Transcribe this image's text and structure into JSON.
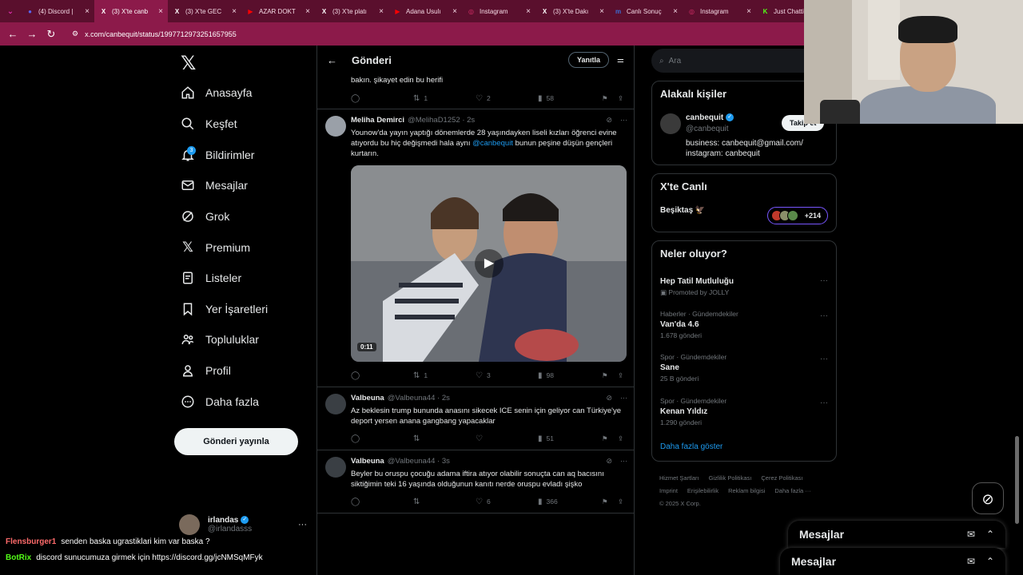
{
  "browser": {
    "tabs": [
      {
        "label": "(4) Discord |",
        "icon": "discord-icon",
        "icon_char": "●",
        "icon_color": "#5865f2",
        "active": false
      },
      {
        "label": "(3) X'te canb",
        "icon": "x-icon",
        "icon_char": "X",
        "icon_color": "#ffffff",
        "active": true
      },
      {
        "label": "(3) X'te GEC",
        "icon": "x-icon",
        "icon_char": "X",
        "icon_color": "#ffffff",
        "active": false
      },
      {
        "label": "AZAR DOKT",
        "icon": "youtube-icon",
        "icon_char": "▶",
        "icon_color": "#ff0000",
        "active": false
      },
      {
        "label": "(3) X'te platı",
        "icon": "x-icon",
        "icon_char": "X",
        "icon_color": "#ffffff",
        "active": false
      },
      {
        "label": "Adana Usulı",
        "icon": "youtube-icon",
        "icon_char": "▶",
        "icon_color": "#ff0000",
        "active": false
      },
      {
        "label": "Instagram",
        "icon": "instagram-icon",
        "icon_char": "◎",
        "icon_color": "#e1306c",
        "active": false
      },
      {
        "label": "(3) X'te Dakı",
        "icon": "x-icon",
        "icon_char": "X",
        "icon_color": "#ffffff",
        "active": false
      },
      {
        "label": "Canlı Sonuç",
        "icon": "mackolik-icon",
        "icon_char": "m",
        "icon_color": "#3b6fd6",
        "active": false
      },
      {
        "label": "Instagram",
        "icon": "instagram-icon",
        "icon_char": "◎",
        "icon_color": "#e1306c",
        "active": false
      },
      {
        "label": "Just Chatti",
        "icon": "kick-icon",
        "icon_char": "K",
        "icon_color": "#53fc18",
        "active": false
      }
    ],
    "url": "x.com/canbequit/status/1997712973251657955"
  },
  "sidebar": {
    "items": [
      {
        "label": "Anasayfa",
        "icon": "home-icon"
      },
      {
        "label": "Keşfet",
        "icon": "search-icon"
      },
      {
        "label": "Bildirimler",
        "icon": "bell-icon",
        "badge": "3"
      },
      {
        "label": "Mesajlar",
        "icon": "mail-icon"
      },
      {
        "label": "Grok",
        "icon": "grok-icon"
      },
      {
        "label": "Premium",
        "icon": "x-logo-icon"
      },
      {
        "label": "Listeler",
        "icon": "list-icon"
      },
      {
        "label": "Yer İşaretleri",
        "icon": "bookmark-icon"
      },
      {
        "label": "Topluluklar",
        "icon": "communities-icon"
      },
      {
        "label": "Profil",
        "icon": "person-icon"
      },
      {
        "label": "Daha fazla",
        "icon": "more-circle-icon"
      }
    ],
    "post_button": "Gönderi yayınla",
    "account": {
      "name": "irlandas",
      "handle": "@irlandasss"
    }
  },
  "main": {
    "title": "Gönderi",
    "reply_button": "Yanıtla",
    "top_fragment": "bakın. şikayet edin bu herifi",
    "top_actions": {
      "replies": "",
      "reposts": "1",
      "likes": "2",
      "views": "58"
    },
    "tweets": [
      {
        "name": "Meliha Demirci",
        "meta": "@MelihaD1252 · 2s",
        "text_before": "Younow'da yayın yaptığı dönemlerde 28 yaşındayken liseli kızları öğrenci evine atıyordu bu hiç değişmedi hala aynı ",
        "mention": "@canbequit",
        "text_after": " bunun peşine düşün gençleri kurtarın.",
        "video_time": "0:11",
        "actions": {
          "replies": "",
          "reposts": "1",
          "likes": "3",
          "views": "98"
        }
      },
      {
        "name": "Valbeuna",
        "meta": "@Valbeuna44 · 2s",
        "text": "Az beklesin trump bununda anasını sikecek ICE senin için geliyor can Türkiye'ye deport yersen anana gangbang yapacaklar",
        "actions": {
          "replies": "",
          "reposts": "",
          "likes": "",
          "views": "51"
        }
      },
      {
        "name": "Valbeuna",
        "meta": "@Valbeuna44 · 3s",
        "text": "Beyler bu oruspu çocuğu adama iftira atıyor olabilir sonuçta can aq bacısını siktiğimin teki 16 yaşında olduğunun kanıtı nerde oruspu evladı şişko",
        "actions": {
          "replies": "",
          "reposts": "",
          "likes": "6",
          "views": "366"
        }
      }
    ]
  },
  "right": {
    "search_placeholder": "Ara",
    "related": {
      "title": "Alakalı kişiler",
      "name": "canbequit",
      "handle": "@canbequit",
      "follow": "Takip et",
      "bio": "business: canbequit@gmail.com/ instagram: canbequit"
    },
    "live": {
      "title": "X'te Canlı",
      "team": "Beşiktaş",
      "count": "+214"
    },
    "trends_title": "Neler oluyor?",
    "trends": [
      {
        "category": "",
        "name": "Hep Tatil Mutluluğu",
        "count": "Promoted by JOLLY"
      },
      {
        "category": "Haberler · Gündemdekiler",
        "name": "Van'da 4.6",
        "count": "1.678 gönderi"
      },
      {
        "category": "Spor · Gündemdekiler",
        "name": "Sane",
        "count": "25 B gönderi"
      },
      {
        "category": "Spor · Gündemdekiler",
        "name": "Kenan Yıldız",
        "count": "1.290 gönderi"
      }
    ],
    "show_more": "Daha fazla göster",
    "footer": [
      "Hizmet Şartları",
      "Gizlilik Politikası",
      "Çerez Politikası",
      "Imprint",
      "Erişilebilirlik",
      "Reklam bilgisi",
      "Daha fazla ···",
      "© 2025 X Corp."
    ]
  },
  "messages_drawers": [
    "Mesajlar",
    "Mesajlar"
  ],
  "chat": [
    {
      "user": "Flensburger1",
      "color": "#ff6b6b",
      "text": "senden baska ugrastiklari kim var baska ?"
    },
    {
      "user": "BotRix",
      "color": "#53fc18",
      "text": "discord sunucumuza girmek için https://discord.gg/jcNMSqMFyk"
    }
  ]
}
